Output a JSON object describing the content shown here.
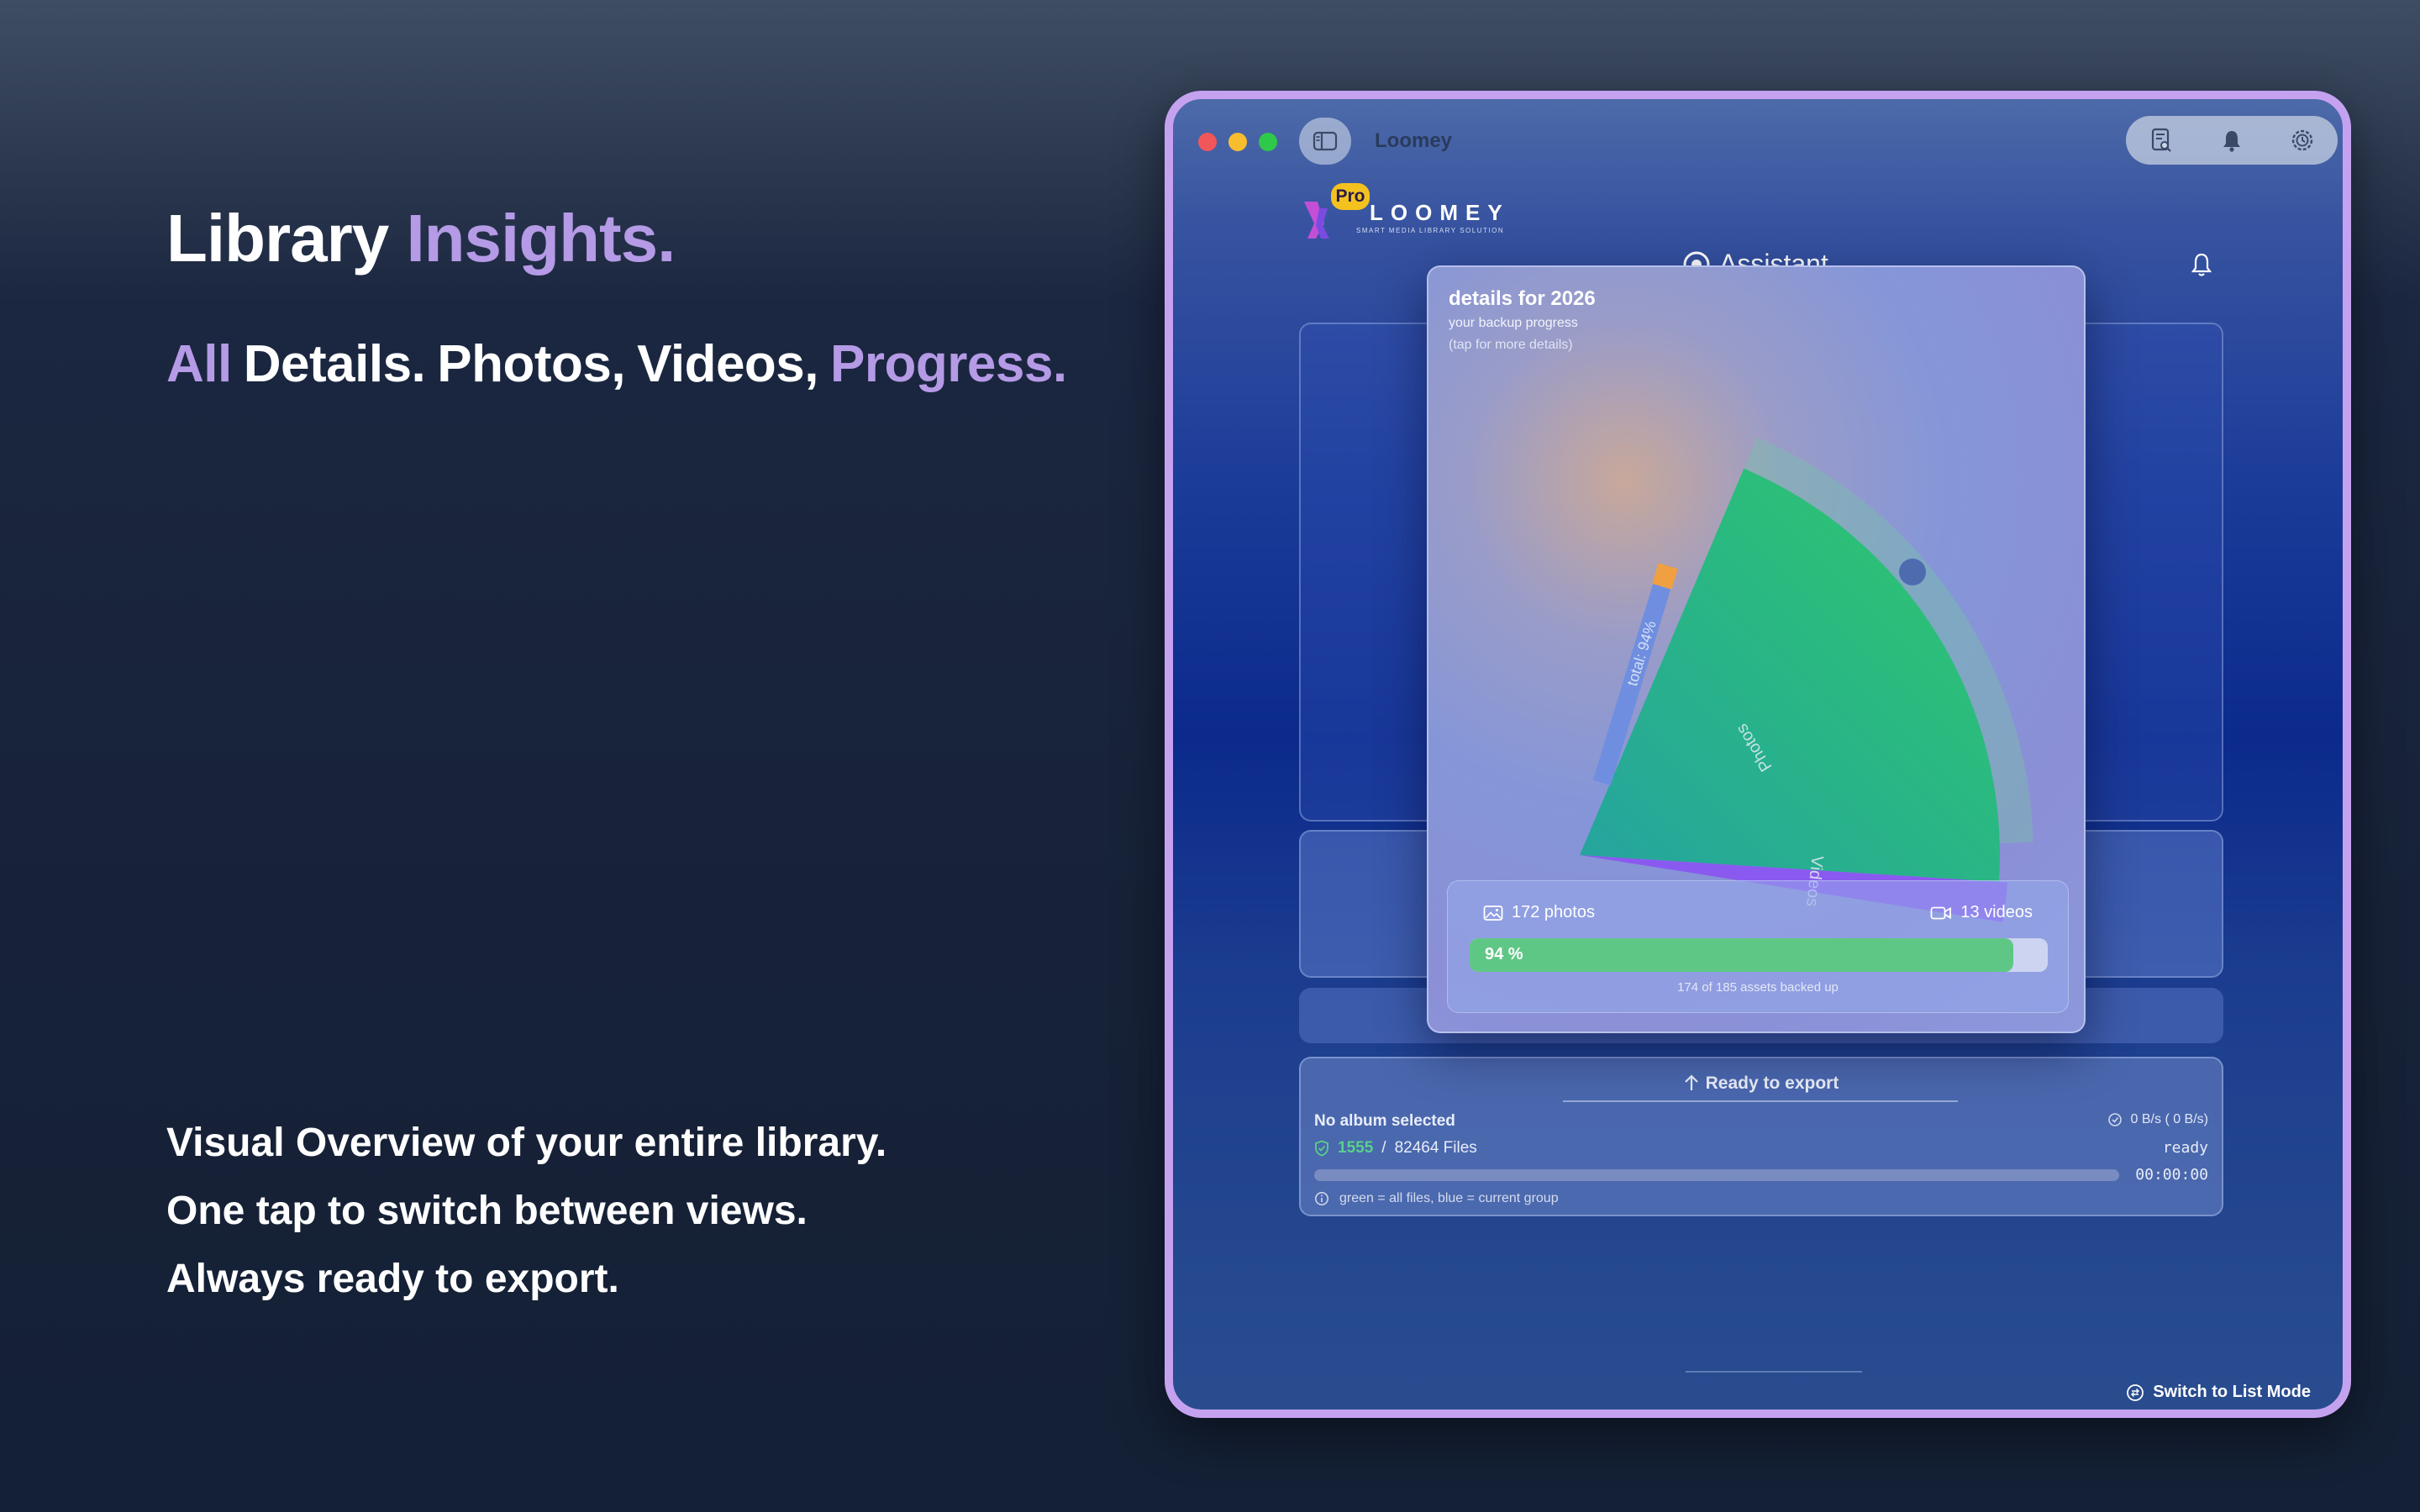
{
  "marketing": {
    "headline_1": "Library",
    "headline_2": "Insights.",
    "sub_all": "All",
    "sub_details": "Details.",
    "sub_photos": "Photos,",
    "sub_videos": "Videos,",
    "sub_progress": "Progress.",
    "feature_1": "Visual Overview of your entire library.",
    "feature_2": "One tap to switch between views.",
    "feature_3": "Always ready to export."
  },
  "window": {
    "title": "Loomey",
    "toolbar_icons": [
      "log-search-icon",
      "bell-icon",
      "settings-clock-icon"
    ]
  },
  "logo": {
    "badge": "Pro",
    "word": "LOOMEY",
    "tagline": "SMART MEDIA LIBRARY SOLUTION"
  },
  "assistant": {
    "label": "Assistant"
  },
  "detail_card": {
    "title": "details for 2026",
    "subtitle": "your backup progress",
    "hint": "(tap for more details)",
    "total_label": "total: 94%",
    "photos_count": "172 photos",
    "videos_count": "13 videos",
    "progress_percent": 94,
    "progress_label": "94 %",
    "backed_up_text": "174 of 185 assets backed up"
  },
  "chart_data": {
    "type": "pie",
    "title": "details for 2026",
    "segments": [
      {
        "label": "Photos",
        "value": 172,
        "color": "#2fb58a"
      },
      {
        "label": "Videos",
        "value": 13,
        "color": "#8a5af0"
      }
    ],
    "total_label": "total: 94%",
    "total_percent": 94
  },
  "export": {
    "ready_label": "Ready to export",
    "album": "No album selected",
    "speed": "0 B/s (  0 B/s)",
    "done_count": "1555",
    "separator": "/",
    "total_files": "82464 Files",
    "status": "ready",
    "timer": "00:00:00",
    "hint": "green = all files, blue = current group"
  },
  "footer": {
    "switch_mode": "Switch to List Mode"
  },
  "colors": {
    "accent": "#b59ae6",
    "window_border": "#c5a2ef",
    "progress_green": "#5fc785",
    "pro_badge": "#f4c21f"
  }
}
